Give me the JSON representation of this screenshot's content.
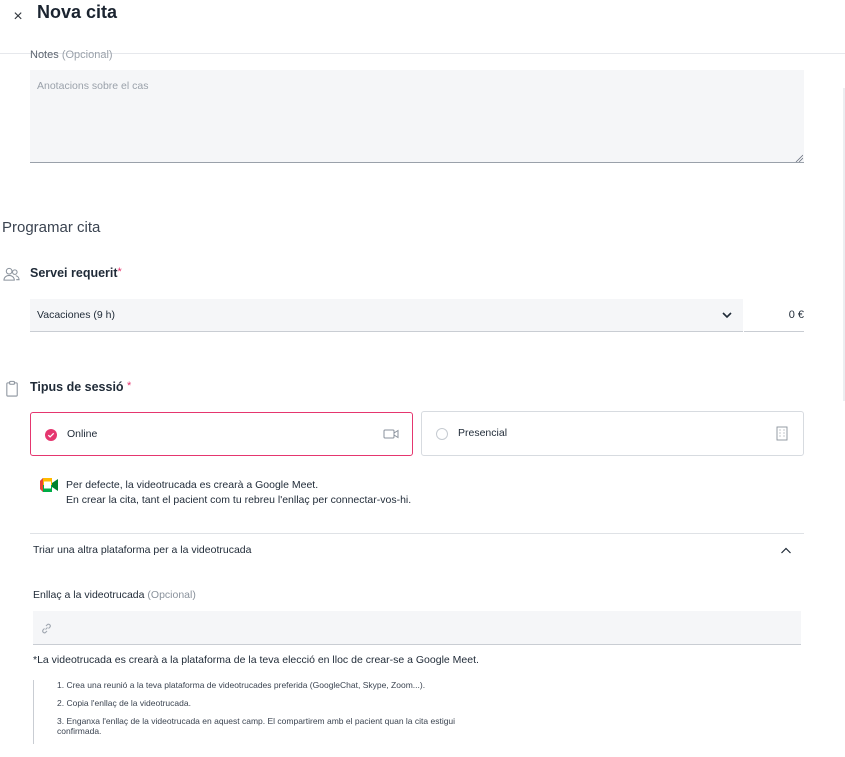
{
  "header": {
    "title": "Nova cita",
    "close_glyph": "×"
  },
  "notes": {
    "label": "Notes",
    "optional": "(Opcional)",
    "placeholder": "Anotacions sobre el cas",
    "value": ""
  },
  "schedule": {
    "title": "Programar cita"
  },
  "service": {
    "label": "Servei requerit",
    "required_mark": "*",
    "selected": "Vacaciones (9 h)",
    "price": "0 €",
    "icon": "users-icon"
  },
  "session": {
    "label": "Tipus de sessió",
    "required_mark": "*",
    "icon": "clipboard-icon",
    "options": [
      {
        "label": "Online",
        "selected": true,
        "icon": "video-camera-icon"
      },
      {
        "label": "Presencial",
        "selected": false,
        "icon": "building-icon"
      }
    ]
  },
  "meet_info": {
    "icon": "google-meet-icon",
    "line1": "Per defecte, la videotrucada es crearà a Google Meet.",
    "line2": "En crear la cita, tant el pacient com tu rebreu l'enllaç per connectar-vos-hi."
  },
  "other_platform": {
    "label": "Triar una altra plataforma per a la videotrucada",
    "expanded": true,
    "link_label": "Enllaç a la videotrucada",
    "link_optional": "(Opcional)",
    "link_placeholder": "",
    "note": "*La videotrucada es crearà a la plataforma de la teva elecció en lloc de crear-se a Google Meet.",
    "steps": [
      "1. Crea una reunió a la teva plataforma de videotrucades preferida (GoogleChat, Skype, Zoom...).",
      "2. Copia l'enllaç de la videotrucada.",
      "3. Enganxa l'enllaç de la videotrucada en aquest camp. El compartirem amb el pacient quan la cita estigui confirmada."
    ]
  },
  "colors": {
    "accent": "#e5366f",
    "field_bg": "#f5f6f8",
    "border": "#d7dbe0"
  }
}
